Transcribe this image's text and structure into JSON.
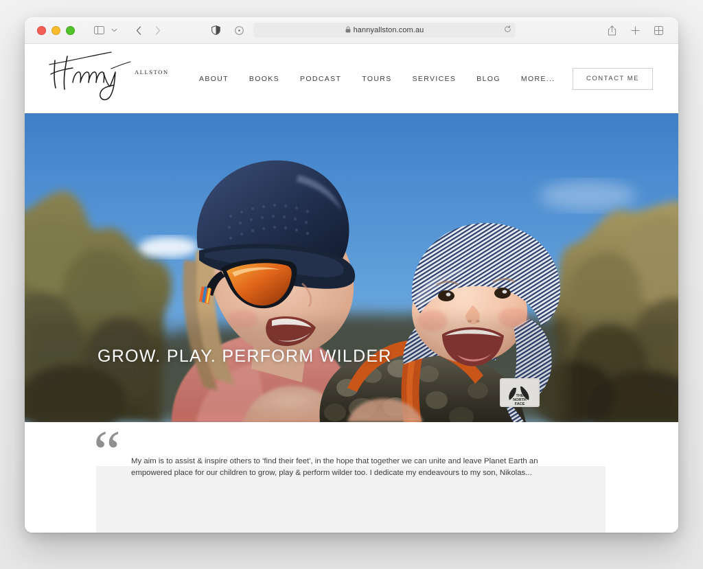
{
  "browser": {
    "url": "hannyallston.com.au",
    "icons": {
      "sidebar": "sidebar-icon",
      "tab_group_chevron": "chevron-down-icon",
      "back": "back-arrow-icon",
      "forward": "forward-arrow-icon",
      "reader": "reader-shield-icon",
      "page_settings": "page-settings-icon",
      "lock": "lock-icon",
      "reload": "reload-icon",
      "share": "share-icon",
      "new_tab": "plus-icon",
      "tab_overview": "tab-overview-icon"
    },
    "traffic_lights": [
      "close",
      "minimize",
      "zoom"
    ]
  },
  "site": {
    "logo": {
      "script_name": "Hanny",
      "surname": "ALLSTON"
    },
    "nav": [
      {
        "label": "ABOUT"
      },
      {
        "label": "BOOKS"
      },
      {
        "label": "PODCAST"
      },
      {
        "label": "TOURS"
      },
      {
        "label": "SERVICES"
      },
      {
        "label": "BLOG"
      },
      {
        "label": "MORE..."
      }
    ],
    "contact_button": "CONTACT ME",
    "hero": {
      "title": "GROW. PLAY. PERFORM WILDER",
      "image_alt": "Woman in navy cap and orange sunglasses holding a smiling baby in a striped bonnet and fleece jacket, bushland and blue sky behind"
    },
    "quote": {
      "mark": "“",
      "text": "My aim is to assist & inspire others to 'find their feet', in the hope that together we can unite and leave Planet Earth an empowered place for our children to grow, play & perform wilder too. I dedicate my endeavours to my son, Nikolas..."
    }
  },
  "colors": {
    "panel_grey": "#f2f2f2",
    "quote_mark_grey": "#8f8f8f",
    "nav_text": "#3c3c3c",
    "hero_sky": "#5a90cd",
    "cap_navy": "#2a3d63",
    "sunglass_orange": "#e06a18",
    "shirt_pink": "#e08a84",
    "desktop_bg": "#ececec"
  }
}
